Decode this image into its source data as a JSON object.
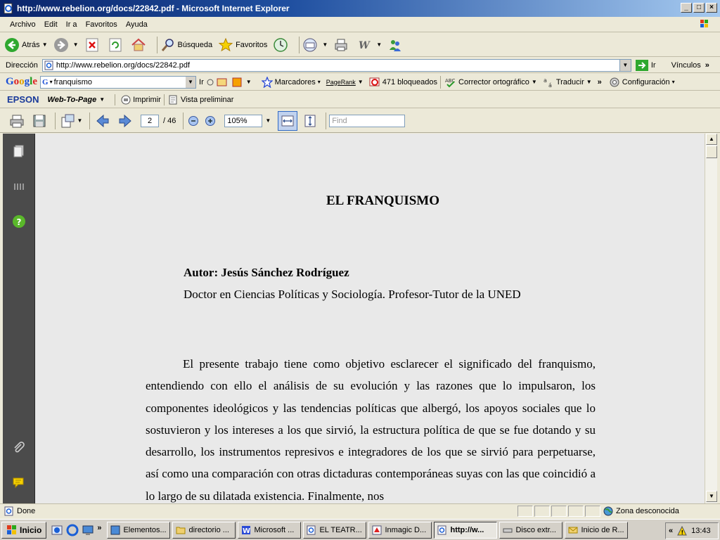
{
  "window": {
    "title": "http://www.rebelion.org/docs/22842.pdf - Microsoft Internet Explorer",
    "minimize": "_",
    "maximize": "□",
    "close": "×"
  },
  "menu": [
    "Archivo",
    "Edit",
    "Ir a",
    "Favoritos",
    "Ayuda"
  ],
  "toolbar": {
    "back": "Atrás",
    "search": "Búsqueda",
    "favorites": "Favoritos"
  },
  "address": {
    "label": "Dirección",
    "url": "http://www.rebelion.org/docs/22842.pdf",
    "go": "Ir",
    "links": "Vínculos"
  },
  "google_bar": {
    "query": "franquismo",
    "go": "Ir",
    "bookmarks": "Marcadores",
    "pagerank": "PageRank",
    "blocked": "471 bloqueados",
    "spellcheck": "Corrector ortográfico",
    "translate": "Traducir",
    "settings": "Configuración"
  },
  "epson_bar": {
    "brand": "EPSON",
    "web_to_page": "Web-To-Page",
    "print": "Imprimir",
    "preview": "Vista preliminar"
  },
  "pdf_toolbar": {
    "page": "2",
    "total": "/ 46",
    "zoom": "105%",
    "find_placeholder": "Find"
  },
  "document": {
    "title": "EL FRANQUISMO",
    "author": "Autor: Jesús Sánchez Rodríguez",
    "role": "Doctor en Ciencias Políticas y Sociología. Profesor-Tutor de la UNED",
    "paragraph": "El presente trabajo tiene como objetivo esclarecer el significado del franquismo, entendiendo con ello el análisis de su evolución y las razones que lo impulsaron, los componentes ideológicos y las tendencias políticas que albergó, los apoyos sociales que lo sostuvieron y los intereses a los que sirvió, la estructura política de que se fue dotando y su desarrollo, los instrumentos represivos e integradores de los que se sirvió para perpetuarse, así como una comparación con otras dictaduras contemporáneas suyas con las que coincidió a lo largo de su dilatada existencia. Finalmente, nos"
  },
  "status": {
    "text": "Done",
    "zone": "Zona desconocida"
  },
  "taskbar": {
    "start": "Inicio",
    "tasks": [
      "Elementos...",
      "directorio ...",
      "Microsoft ...",
      "EL TEATR...",
      "Inmagic D...",
      "http://w...",
      "Disco extr...",
      "Inicio de R..."
    ],
    "clock": "13:43",
    "tray_expand": "«"
  },
  "colors": {
    "titlebar": "#0a246a",
    "side_panel": "#4b4b4b",
    "page_bg": "#e9e9e9"
  }
}
